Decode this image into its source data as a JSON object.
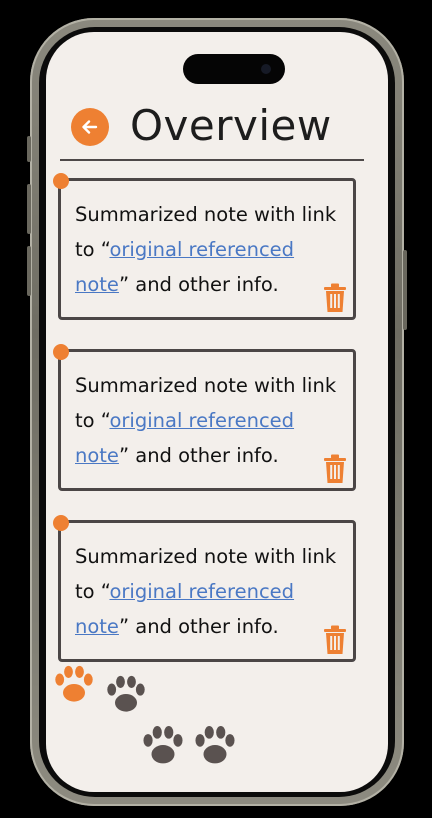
{
  "header": {
    "title": "Overview",
    "back_icon": "arrow-left-icon",
    "accent_color": "#ee8032"
  },
  "notes": [
    {
      "text_before": "Summarized note with link to “",
      "link_text": "original referenced note",
      "text_after": "” and other info.",
      "delete_icon": "trash-icon"
    },
    {
      "text_before": "Summarized note with link to “",
      "link_text": "original referenced note",
      "text_after": "” and other info.",
      "delete_icon": "trash-icon"
    },
    {
      "text_before": "Summarized note with link to “",
      "link_text": "original referenced note",
      "text_after": "” and other info.",
      "delete_icon": "trash-icon"
    }
  ],
  "decorations": {
    "icon": "paw-print-icon",
    "colors": [
      "#ee8032",
      "#5a5250"
    ]
  },
  "colors": {
    "screen_background": "#f3efeb",
    "card_border": "#4b4646",
    "link": "#4a78c4",
    "text": "#111111"
  }
}
